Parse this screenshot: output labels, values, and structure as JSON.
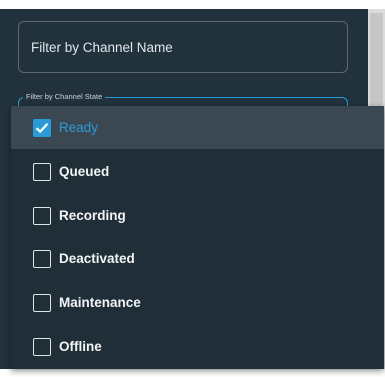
{
  "name_filter": {
    "placeholder": "Filter by Channel Name"
  },
  "state_filter": {
    "label": "Filter by Channel State"
  },
  "state_options": [
    {
      "label": "Ready",
      "checked": true
    },
    {
      "label": "Queued",
      "checked": false
    },
    {
      "label": "Recording",
      "checked": false
    },
    {
      "label": "Deactivated",
      "checked": false
    },
    {
      "label": "Maintenance",
      "checked": false
    },
    {
      "label": "Offline",
      "checked": false
    }
  ],
  "colors": {
    "panel_background": "#22323c",
    "dropdown_background": "#1f2e37",
    "selected_row": "#3b4851",
    "accent": "#2a9bd8",
    "text": "#f2f5f7"
  },
  "icons": {
    "checked": "check-icon"
  }
}
